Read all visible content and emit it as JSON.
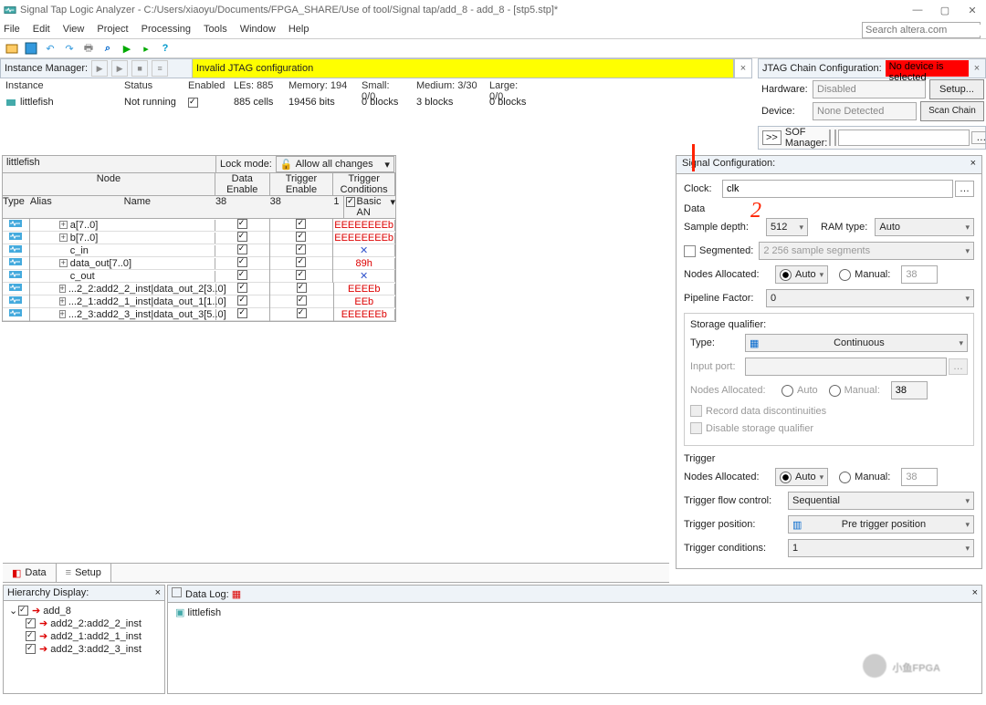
{
  "window": {
    "title": "Signal Tap Logic Analyzer - C:/Users/xiaoyu/Documents/FPGA_SHARE/Use of tool/Signal tap/add_8 - add_8 - [stp5.stp]*"
  },
  "menu": [
    "File",
    "Edit",
    "View",
    "Project",
    "Processing",
    "Tools",
    "Window",
    "Help"
  ],
  "search_placeholder": "Search altera.com",
  "instance_manager": {
    "label": "Instance Manager:",
    "message": "Invalid JTAG configuration"
  },
  "jtag": {
    "label": "JTAG Chain Configuration:",
    "message": "No device is selected"
  },
  "inst_headers": [
    "Instance",
    "Status",
    "Enabled",
    "LEs: 885",
    "Memory: 194",
    "Small: 0/0",
    "Medium: 3/30",
    "Large: 0/0"
  ],
  "inst_row": {
    "name": "littlefish",
    "status": "Not running",
    "enabled": true,
    "les": "885 cells",
    "memory": "19456 bits",
    "small": "0 blocks",
    "medium": "3 blocks",
    "large": "0 blocks"
  },
  "hardware": {
    "hw_label": "Hardware:",
    "hw_value": "Disabled",
    "setup": "Setup...",
    "dev_label": "Device:",
    "dev_value": "None Detected",
    "scan": "Scan Chain",
    "sof_label": "SOF Manager:",
    "gtgt": ">>"
  },
  "node_panel": {
    "title": "littlefish",
    "lock_label": "Lock mode:",
    "lock_value": "Allow all changes",
    "grp_node": "Node",
    "hdr_type": "Type",
    "hdr_alias": "Alias",
    "hdr_name": "Name",
    "hdr_de": "Data Enable",
    "hdr_te": "Trigger Enable",
    "hdr_tc": "Trigger Conditions",
    "sub_de": "38",
    "sub_te": "38",
    "sub_tc_l": "1",
    "sub_tc_r": "Basic AN"
  },
  "rows": [
    {
      "name": "a[7..0]",
      "tc": "EEEEEEEEb",
      "cls": "tc-red",
      "exp": true
    },
    {
      "name": "b[7..0]",
      "tc": "EEEEEEEEb",
      "cls": "tc-red",
      "exp": true
    },
    {
      "name": "c_in",
      "tc": "✕",
      "cls": "tc-blue",
      "exp": false
    },
    {
      "name": "data_out[7..0]",
      "tc": "89h",
      "cls": "tc-red",
      "exp": true
    },
    {
      "name": "c_out",
      "tc": "✕",
      "cls": "tc-blue",
      "exp": false
    },
    {
      "name": "...2_2:add2_2_inst|data_out_2[3..0]",
      "tc": "EEEEb",
      "cls": "tc-red",
      "exp": true
    },
    {
      "name": "...2_1:add2_1_inst|data_out_1[1..0]",
      "tc": "EEb",
      "cls": "tc-red",
      "exp": true
    },
    {
      "name": "...2_3:add2_3_inst|data_out_3[5..0]",
      "tc": "EEEEEEb",
      "cls": "tc-red",
      "exp": true
    }
  ],
  "sigconf": {
    "title": "Signal Configuration:",
    "clock_label": "Clock:",
    "clock_value": "clk",
    "data_label": "Data",
    "sample_depth_label": "Sample depth:",
    "sample_depth_value": "512",
    "ram_type_label": "RAM type:",
    "ram_type_value": "Auto",
    "segmented_label": "Segmented:",
    "segmented_value": "2  256 sample segments",
    "nodes_alloc_label": "Nodes Allocated:",
    "auto": "Auto",
    "manual": "Manual:",
    "manual_value": "38",
    "pipeline_label": "Pipeline Factor:",
    "pipeline_value": "0",
    "storage_title": "Storage qualifier:",
    "type_label": "Type:",
    "type_value": "Continuous",
    "input_port_label": "Input port:",
    "record_disc": "Record data discontinuities",
    "disable_sq": "Disable storage qualifier",
    "trigger_title": "Trigger",
    "flow_label": "Trigger flow control:",
    "flow_value": "Sequential",
    "pos_label": "Trigger position:",
    "pos_value": "Pre trigger position",
    "cond_label": "Trigger conditions:",
    "cond_value": "1"
  },
  "tabs": {
    "data": "Data",
    "setup": "Setup"
  },
  "hdisplay": {
    "title": "Hierarchy Display:",
    "root": "add_8",
    "children": [
      "add2_2:add2_2_inst",
      "add2_1:add2_1_inst",
      "add2_3:add2_3_inst"
    ]
  },
  "dlog": {
    "title": "Data Log:",
    "item": "littlefish"
  },
  "watermark": "小鱼FPGA",
  "annotation2": "2"
}
